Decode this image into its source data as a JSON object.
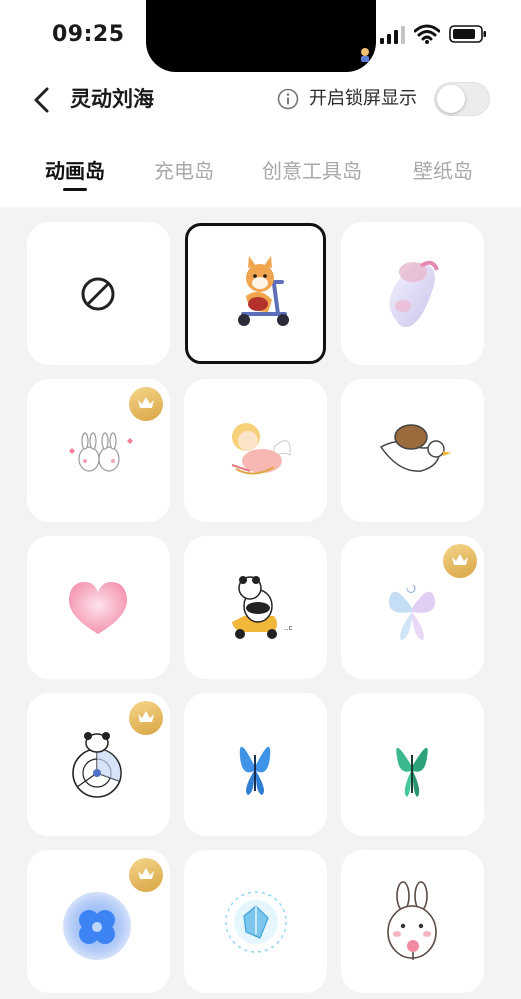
{
  "status_bar": {
    "time": "09:25"
  },
  "header": {
    "back_icon": "chevron-left-icon",
    "title": "灵动刘海",
    "lock_label": "开启锁屏显示",
    "lock_toggle_on": false
  },
  "tabs": [
    {
      "label": "动画岛",
      "active": true
    },
    {
      "label": "充电岛",
      "active": false
    },
    {
      "label": "创意工具岛",
      "active": false
    },
    {
      "label": "壁纸岛",
      "active": false
    }
  ],
  "grid": {
    "items": [
      {
        "name": "none",
        "icon": "none-icon",
        "premium": false,
        "selected": false
      },
      {
        "name": "corgi-scooter",
        "icon": "corgi-scooter-icon",
        "premium": false,
        "selected": true
      },
      {
        "name": "3d-bunny",
        "icon": "3d-bunny-icon",
        "premium": false,
        "selected": false
      },
      {
        "name": "twin-bunnies",
        "icon": "twin-bunnies-icon",
        "premium": true,
        "selected": false
      },
      {
        "name": "cupid",
        "icon": "cupid-icon",
        "premium": false,
        "selected": false
      },
      {
        "name": "capybara-goose",
        "icon": "capybara-goose-icon",
        "premium": false,
        "selected": false
      },
      {
        "name": "heart",
        "icon": "heart-icon",
        "premium": false,
        "selected": false
      },
      {
        "name": "panda-scooter",
        "icon": "panda-scooter-icon",
        "premium": false,
        "selected": false
      },
      {
        "name": "crystal-butterfly",
        "icon": "crystal-butterfly-icon",
        "premium": true,
        "selected": false
      },
      {
        "name": "panda-fan",
        "icon": "panda-fan-icon",
        "premium": true,
        "selected": false
      },
      {
        "name": "blue-butterfly",
        "icon": "blue-butterfly-icon",
        "premium": false,
        "selected": false
      },
      {
        "name": "green-butterfly",
        "icon": "green-butterfly-icon",
        "premium": false,
        "selected": false
      },
      {
        "name": "blue-swirl",
        "icon": "blue-swirl-icon",
        "premium": true,
        "selected": false
      },
      {
        "name": "ice-crystal",
        "icon": "ice-crystal-icon",
        "premium": false,
        "selected": false
      },
      {
        "name": "bunny-lollipop",
        "icon": "bunny-lollipop-icon",
        "premium": false,
        "selected": false
      }
    ]
  },
  "colors": {
    "background": "#f3f3f3",
    "card": "#ffffff",
    "crown_gold": "#e0ad4f",
    "active_tab": "#111111",
    "inactive_tab": "#a9a9a9"
  }
}
